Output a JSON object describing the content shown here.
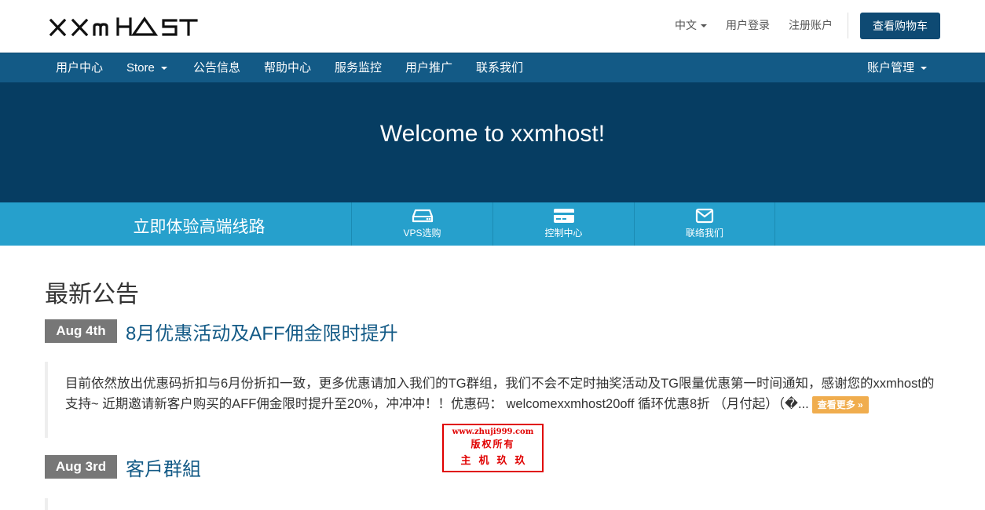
{
  "header": {
    "logo_text": "XXmHOST",
    "lang": "中文",
    "login": "用户登录",
    "register": "注册账户",
    "cart": "查看购物车"
  },
  "nav": {
    "items": [
      "用户中心",
      "Store",
      "公告信息",
      "帮助中心",
      "服务监控",
      "用户推广",
      "联系我们"
    ],
    "account": "账户管理"
  },
  "hero": {
    "title": "Welcome to xxmhost!"
  },
  "strip": {
    "lead": "立即体验高端线路",
    "cells": [
      {
        "label": "VPS选购",
        "icon": "server-icon"
      },
      {
        "label": "控制中心",
        "icon": "credit-card-icon"
      },
      {
        "label": "联络我们",
        "icon": "envelope-icon"
      }
    ]
  },
  "announcements": {
    "title": "最新公告",
    "items": [
      {
        "date": "Aug 4th",
        "title": "8月优惠活动及AFF佣金限时提升",
        "body": "目前依然放出优惠码折扣与6月份折扣一致，更多优惠请加入我们的TG群组，我们不会不定时抽奖活动及TG限量优惠第一时间通知，感谢您的xxmhost的支持~ 近期邀请新客户购买的AFF佣金限时提升至20%，冲冲冲！！优惠码： welcomexxmhost20off  循环优惠8折 （月付起）（�...",
        "more": "查看更多 »"
      },
      {
        "date": "Aug 3rd",
        "title": "客戶群組"
      }
    ]
  },
  "watermark": {
    "line1": "www.zhuji999.com",
    "line2": "版权所有",
    "line3": "主机玖玖"
  },
  "colors": {
    "brand_dark": "#063d62",
    "nav": "#135a86",
    "strip": "#26a0cc",
    "more_button": "#f0ad4e"
  }
}
